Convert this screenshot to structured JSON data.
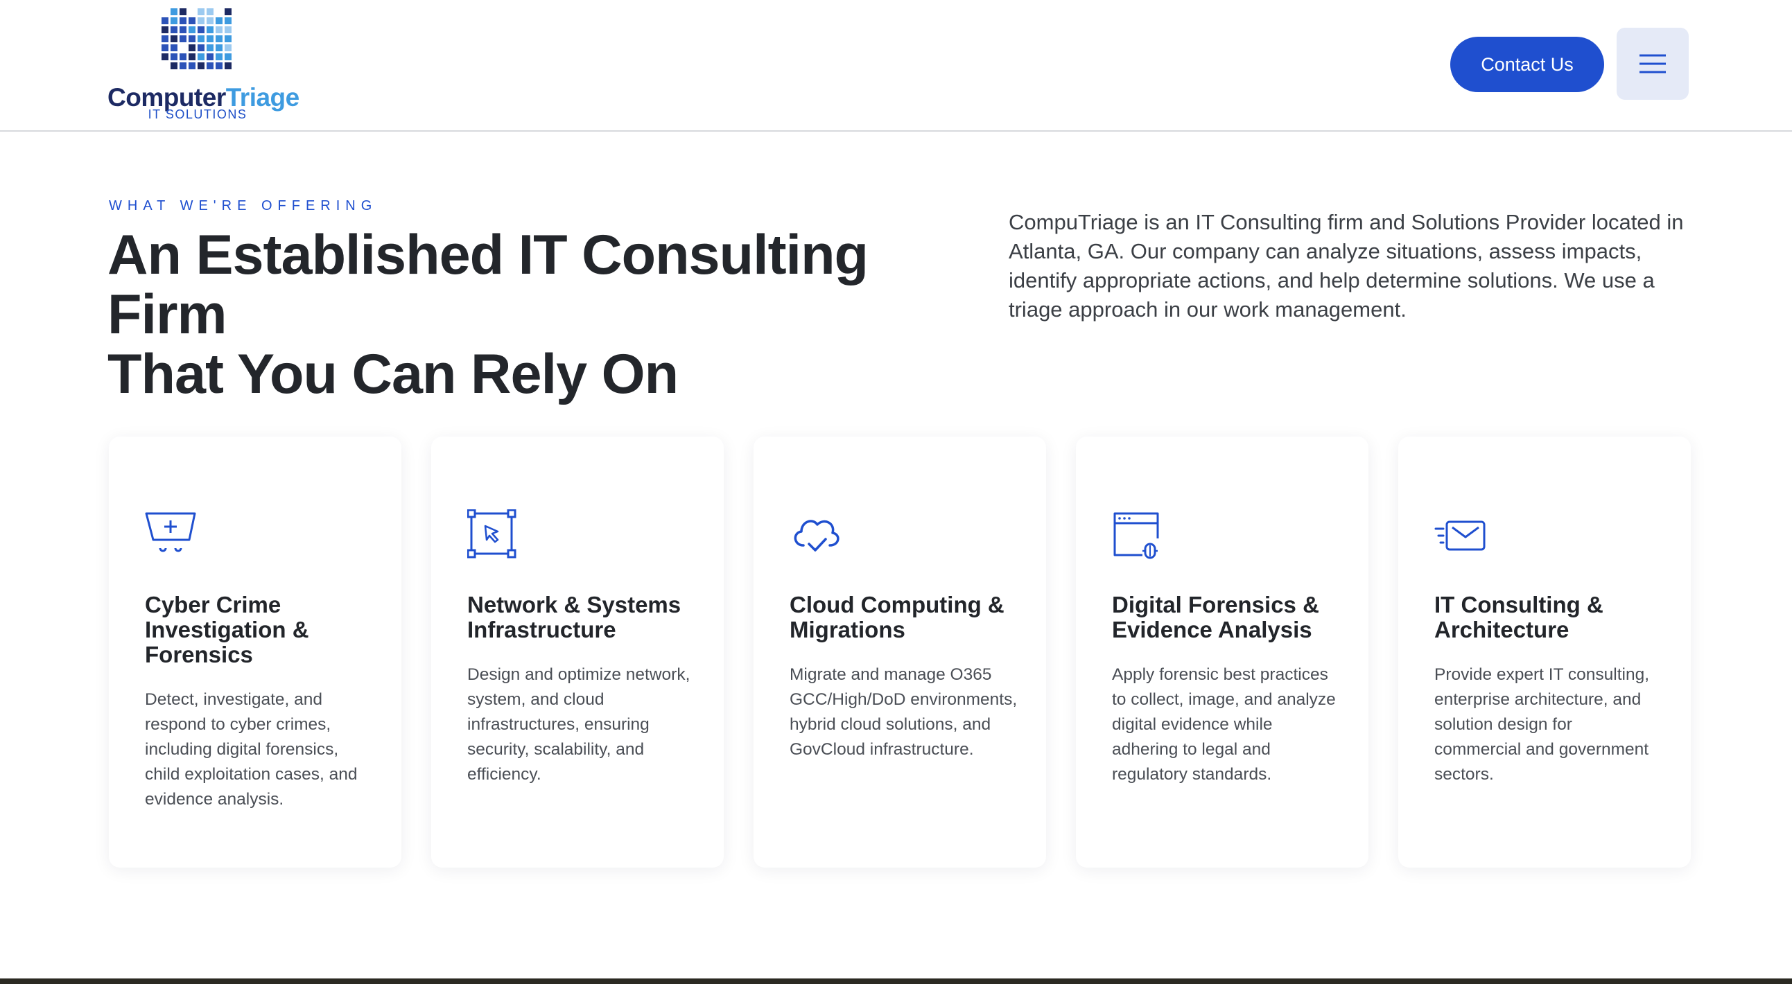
{
  "header": {
    "logo": {
      "word_a": "Computer",
      "word_b": "Triage",
      "sub": "IT SOLUTIONS"
    },
    "contact_label": "Contact Us",
    "menu_icon": "hamburger-menu-icon"
  },
  "hero": {
    "eyebrow": "WHAT WE'RE OFFERING",
    "headline_line1": "An Established IT Consulting Firm",
    "headline_line2": "That You Can Rely On",
    "intro": "CompuTriage is an IT Consulting firm and Solutions Provider located in Atlanta, GA. Our company can analyze situations, assess impacts, identify appropriate actions, and help determine solutions. We use a triage approach in our work management."
  },
  "services": [
    {
      "icon": "shopping-cart-plus-icon",
      "title": "Cyber Crime Investigation & Forensics",
      "description": "Detect, investigate, and respond to cyber crimes, including digital forensics, child exploitation cases, and evidence analysis."
    },
    {
      "icon": "cursor-select-icon",
      "title": "Network & Systems Infrastructure",
      "description": "Design and optimize network, system, and cloud infrastructures, ensuring security, scalability, and efficiency."
    },
    {
      "icon": "cloud-check-icon",
      "title": "Cloud Computing & Migrations",
      "description": "Migrate and manage O365 GCC/High/DoD environments, hybrid cloud solutions, and GovCloud infrastructure."
    },
    {
      "icon": "browser-bug-icon",
      "title": "Digital Forensics & Evidence Analysis",
      "description": "Apply forensic best practices to collect, image, and analyze digital evidence while adhering to legal and regulatory standards."
    },
    {
      "icon": "fast-mail-icon",
      "title": "IT Consulting & Architecture",
      "description": "Provide expert IT consulting, enterprise architecture, and solution design for commercial and government sectors."
    }
  ],
  "colors": {
    "brand_blue": "#1f4fcf",
    "logo_navy": "#1d2a63",
    "logo_light": "#3e9be0",
    "menu_bg": "#e5eaf7",
    "heading": "#23262b",
    "body_text": "#4a4e55"
  }
}
